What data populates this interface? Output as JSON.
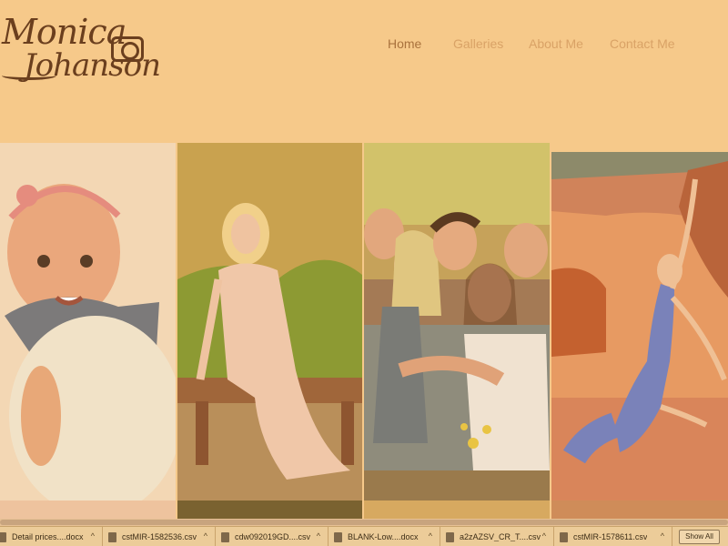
{
  "brand": {
    "line1": "Monica",
    "line2": "Johanson"
  },
  "nav": {
    "home": "Home",
    "galleries": "Galleries",
    "about": "About Me",
    "contact": "Contact Me"
  },
  "gallery": {
    "photos": [
      "baby-portrait",
      "woman-on-bench",
      "family-group",
      "dancer-on-rocks"
    ]
  },
  "downloads": {
    "items": [
      "Detail prices....docx",
      "cstMIR-1582536.csv",
      "cdw092019GD....csv",
      "BLANK-Low....docx",
      "a2zAZSV_CR_T....csv",
      "cstMIR-1578611.csv"
    ],
    "show_all": "Show All",
    "caret": "^"
  }
}
